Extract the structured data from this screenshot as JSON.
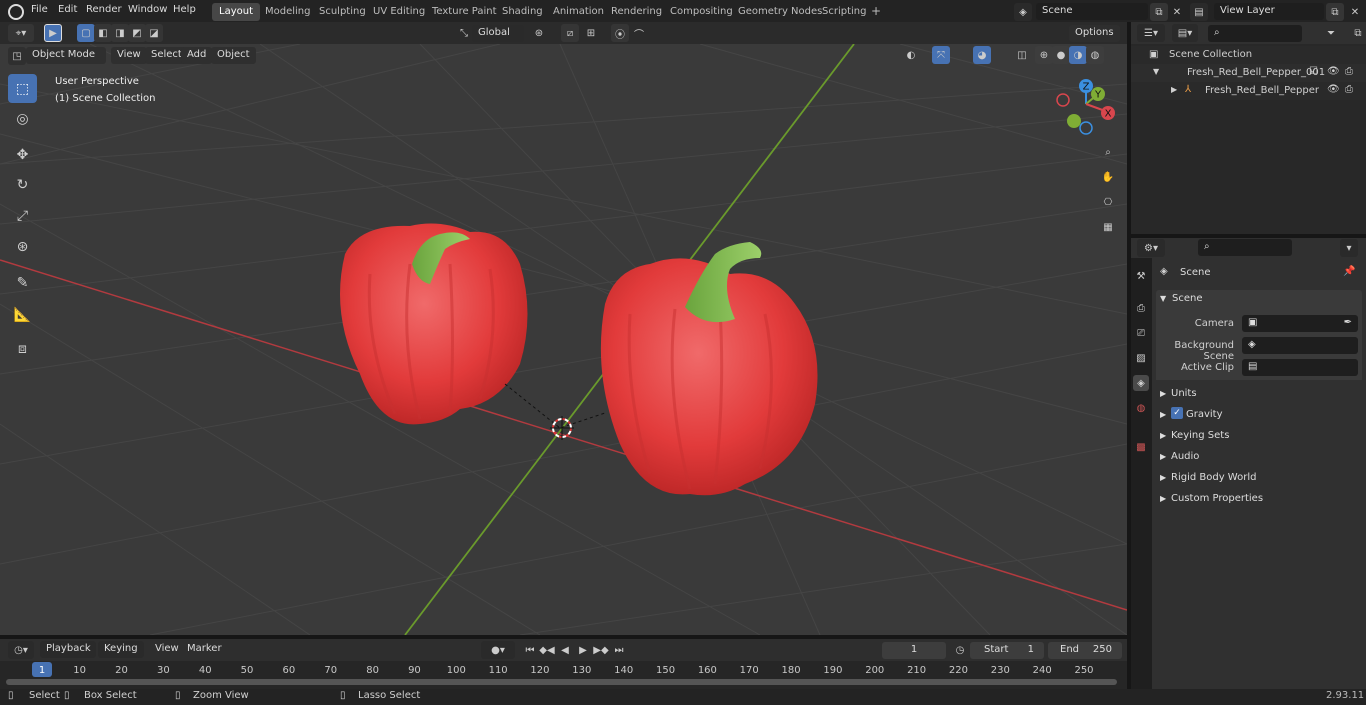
{
  "topbar": {
    "menus": [
      "File",
      "Edit",
      "Render",
      "Window",
      "Help"
    ],
    "workspaces": [
      "Layout",
      "Modeling",
      "Sculpting",
      "UV Editing",
      "Texture Paint",
      "Shading",
      "Animation",
      "Rendering",
      "Compositing",
      "Geometry Nodes",
      "Scripting"
    ],
    "active_workspace": "Layout",
    "add_tab": "+",
    "scene_name": "Scene",
    "view_layer": "View Layer"
  },
  "viewport_header": {
    "mode": "Object Mode",
    "menus": [
      "View",
      "Select",
      "Add",
      "Object"
    ],
    "transform_orientation": "Global",
    "options": "Options"
  },
  "viewport": {
    "perspective": "User Perspective",
    "collection": "(1) Scene Collection",
    "gizmo_axes": [
      "Z",
      "Y",
      "X"
    ],
    "colors": {
      "x_axis": "#d8464d",
      "y_axis": "#7fad35",
      "z_axis": "#3b8fe0",
      "grid": "#454545",
      "bg": "#3a3a3a",
      "pepper": "#e23b3b",
      "stem": "#7bb34a"
    }
  },
  "outliner": {
    "root": "Scene Collection",
    "items": [
      "Fresh_Red_Bell_Pepper_001",
      "Fresh_Red_Bell_Pepper"
    ]
  },
  "properties": {
    "context": "Scene",
    "section": "Scene",
    "fields": [
      {
        "label": "Camera",
        "value": ""
      },
      {
        "label": "Background Scene",
        "value": ""
      },
      {
        "label": "Active Clip",
        "value": ""
      }
    ],
    "panels": [
      "Units",
      "Gravity",
      "Keying Sets",
      "Audio",
      "Rigid Body World",
      "Custom Properties"
    ],
    "gravity_checked": true
  },
  "timeline": {
    "menus": [
      "Playback",
      "Keying",
      "View",
      "Marker"
    ],
    "current_frame": "1",
    "start_label": "Start",
    "start": "1",
    "end_label": "End",
    "end": "250",
    "ticks": [
      "1",
      "10",
      "20",
      "30",
      "40",
      "50",
      "60",
      "70",
      "80",
      "90",
      "100",
      "110",
      "120",
      "130",
      "140",
      "150",
      "160",
      "170",
      "180",
      "190",
      "200",
      "210",
      "220",
      "230",
      "240",
      "250"
    ]
  },
  "statusbar": {
    "select": "Select",
    "box_select": "Box Select",
    "zoom_view": "Zoom View",
    "lasso_select": "Lasso Select",
    "version": "2.93.11"
  }
}
